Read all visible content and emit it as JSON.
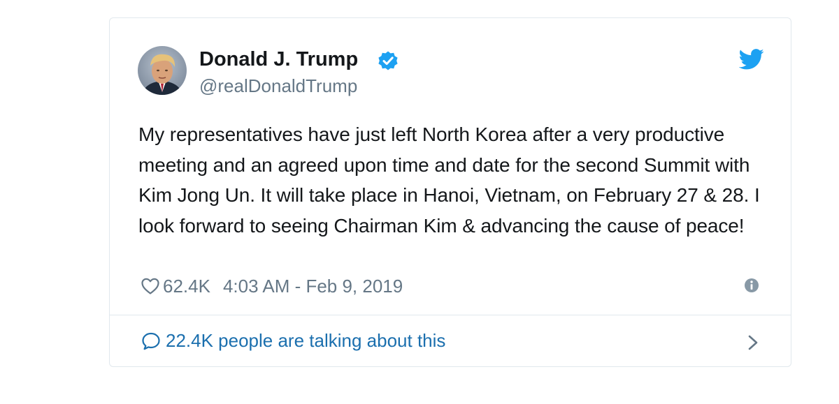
{
  "tweet": {
    "author_name": "Donald J. Trump",
    "author_handle": "@realDonaldTrump",
    "verified": true,
    "text": "My representatives have just left North Korea after a very productive meeting and an agreed upon time and date for the second Summit with Kim Jong Un. It will take place in Hanoi, Vietnam, on February 27 & 28. I look forward to seeing Chairman Kim & advancing the cause of peace!",
    "like_count": "62.4K",
    "timestamp": "4:03 AM - Feb 9, 2019",
    "conversation_label": "22.4K people are talking about this"
  },
  "icons": {
    "avatar": "avatar",
    "verified": "verified-badge-icon",
    "brand": "twitter-bird-icon",
    "like": "heart-icon",
    "info": "info-icon",
    "conversation": "speech-bubble-icon",
    "chevron": "chevron-right-icon"
  },
  "colors": {
    "twitter_blue": "#1da1f2",
    "text_primary": "#14171a",
    "text_secondary": "#657786",
    "link_blue": "#1b6fae",
    "border": "#e1e8ed"
  }
}
